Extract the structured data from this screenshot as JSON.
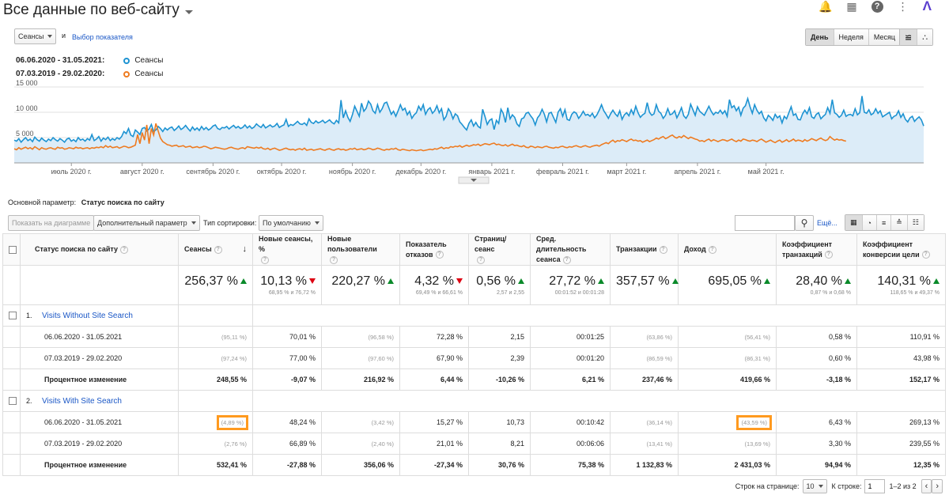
{
  "header": {
    "title": "Все данные по веб-сайту"
  },
  "controls": {
    "metric_select": "Сеансы",
    "and_label": "и",
    "choose_metric": "Выбор показателя",
    "periods": [
      "День",
      "Неделя",
      "Месяц"
    ],
    "active_period": "День"
  },
  "legend": [
    {
      "range": "06.06.2020 - 31.05.2021:",
      "series": "Сеансы",
      "color": "#1d93d2"
    },
    {
      "range": "07.03.2019 - 29.02.2020:",
      "series": "Сеансы",
      "color": "#ee7b21"
    }
  ],
  "chart_data": {
    "type": "line",
    "y_ticks": [
      "15 000",
      "10 000",
      "5 000"
    ],
    "y_tick_values": [
      15000,
      10000,
      5000
    ],
    "ylim": [
      0,
      15000
    ],
    "x_tick_labels": [
      "июль 2020 г.",
      "август 2020 г.",
      "сентябрь 2020 г.",
      "октябрь 2020 г.",
      "ноябрь 2020 г.",
      "декабрь 2020 г.",
      "январь 2021 г.",
      "февраль 2021 г.",
      "март 2021 г.",
      "апрель 2021 г.",
      "май 2021 г."
    ],
    "x_tick_days": [
      25,
      56,
      87,
      117,
      148,
      178,
      209,
      240,
      268,
      299,
      329
    ],
    "series": [
      {
        "name": "Сеансы",
        "color": "#1d93d2",
        "fill": "#dcecf8",
        "values": [
          4500,
          4300,
          4800,
          4100,
          4600,
          5000,
          4400,
          4700,
          4200,
          5100,
          4600,
          4300,
          4900,
          4500,
          4200,
          4700,
          4400,
          5000,
          4600,
          4300,
          4800,
          4500,
          4100,
          4700,
          4900,
          4300,
          4600,
          4200,
          5000,
          4500,
          4700,
          4300,
          4800,
          4500,
          5600,
          4400,
          4700,
          5200,
          4300,
          4900,
          4600,
          5100,
          4400,
          4800,
          4500,
          5000,
          4700,
          5200,
          6200,
          5800,
          6800,
          5500,
          5200,
          6500,
          6100,
          5600,
          6800,
          7000,
          6300,
          6700,
          7600,
          6200,
          6500,
          7200,
          6800,
          6200,
          6900,
          6500,
          6900,
          7100,
          6400,
          6800,
          7300,
          6600,
          6900,
          7400,
          6800,
          6300,
          7100,
          6500,
          6900,
          6400,
          7200,
          6600,
          7000,
          6500,
          6800,
          7300,
          7500,
          6800,
          6600,
          7000,
          6900,
          7200,
          6700,
          7100,
          7400,
          6900,
          7200,
          6800,
          7000,
          7500,
          6900,
          7300,
          6800,
          7100,
          7700,
          7300,
          7000,
          7600,
          6900,
          7200,
          7500,
          7100,
          7300,
          7800,
          7000,
          7300,
          7500,
          8600,
          7200,
          7600,
          7400,
          7800,
          8200,
          7700,
          7600,
          7900,
          7400,
          8700,
          8000,
          7800,
          8300,
          7900,
          8100,
          8400,
          7900,
          8200,
          8500,
          8000,
          7700,
          8400,
          7900,
          12400,
          8900,
          10300,
          9000,
          8200,
          9500,
          11200,
          10200,
          9200,
          11800,
          10200,
          10800,
          12200,
          11600,
          10300,
          9800,
          11500,
          10000,
          10700,
          11800,
          12000,
          10800,
          9600,
          10200,
          9200,
          10300,
          11500,
          10400,
          10800,
          9500,
          10200,
          8800,
          9500,
          9900,
          11200,
          10400,
          11500,
          9600,
          10500,
          10900,
          9800,
          10300,
          11300,
          9900,
          10700,
          8500,
          9200,
          10700,
          10000,
          8700,
          9700,
          9300,
          8100,
          7600,
          7000,
          6500,
          7800,
          8500,
          7300,
          8000,
          7200,
          6900,
          10600,
          9200,
          7600,
          8400,
          8700,
          6600,
          8400,
          7800,
          10600,
          9800,
          8000,
          10900,
          8700,
          9500,
          9000,
          7700,
          7200,
          8700,
          8900,
          9800,
          10000,
          9300,
          8700,
          7500,
          8900,
          9500,
          10600,
          9600,
          8100,
          9800,
          10000,
          9000,
          8000,
          10000,
          10700,
          9200,
          10500,
          8600,
          8400,
          9600,
          10100,
          9800,
          8800,
          9400,
          10200,
          9400,
          9600,
          9200,
          9800,
          8900,
          9500,
          10400,
          11500,
          10300,
          9600,
          8800,
          9700,
          10400,
          9700,
          9200,
          10300,
          8600,
          9500,
          9900,
          9300,
          10500,
          9600,
          11200,
          9900,
          9000,
          9500,
          9800,
          11900,
          10000,
          9400,
          9700,
          11500,
          10200,
          9800,
          8800,
          9400,
          10700,
          9500,
          9700,
          10300,
          8900,
          9800,
          10900,
          9300,
          8800,
          9600,
          11600,
          10500,
          9400,
          11100,
          10200,
          9800,
          9400,
          10300,
          11200,
          10200,
          9500,
          10000,
          9800,
          10400,
          9700,
          10300,
          9200,
          12500,
          10900,
          11300,
          10300,
          11000,
          9400,
          10800,
          11300,
          12700,
          11100,
          9800,
          11500,
          10400,
          9700,
          10200,
          8900,
          8300,
          9400,
          9000,
          8400,
          9600,
          8900,
          9300,
          7900,
          9200,
          8700,
          9900,
          11100,
          9400,
          9700,
          8600,
          8500,
          9700,
          10400,
          9700,
          10900,
          9100,
          8800,
          9600,
          9900,
          8700,
          9200,
          9600,
          10900,
          9800,
          12500,
          9900,
          9600,
          9000,
          9400,
          10400,
          9200,
          9500,
          9600,
          9300,
          10700,
          9500,
          9900,
          13200,
          10000,
          9800,
          10500,
          9500,
          9800,
          10700,
          9800,
          10300,
          9100,
          9400,
          9700,
          10000,
          8700,
          9200,
          9400,
          10300,
          9000,
          9700,
          8600,
          8100,
          8900,
          9200,
          8200,
          8700,
          9100,
          8500,
          7300
        ]
      },
      {
        "name": "Сеансы",
        "color": "#ee7b21",
        "values": [
          2800,
          2600,
          3000,
          2700,
          2900,
          3100,
          2800,
          3000,
          2700,
          3200,
          2900,
          2600,
          3000,
          2800,
          2700,
          2900,
          3000,
          2800,
          2700,
          3100,
          2900,
          3000,
          2700,
          2800,
          3000,
          2900,
          2800,
          3100,
          2900,
          3000,
          2800,
          2900,
          3000,
          2800,
          3000,
          2900,
          3100,
          3000,
          3200,
          3000,
          3400,
          3100,
          3300,
          3000,
          3100,
          3200,
          2900,
          3100,
          3300,
          3200,
          3000,
          3100,
          3300,
          3500,
          5600,
          3800,
          6000,
          4500,
          7500,
          3800,
          6800,
          5500,
          7800,
          6300,
          4900,
          4200,
          3900,
          3600,
          3500,
          3300,
          3400,
          3500,
          3200,
          3300,
          3400,
          3100,
          3200,
          3300,
          3000,
          3100,
          3200,
          3000,
          3100,
          3300,
          3200,
          3000,
          2800,
          2900,
          3100,
          3000,
          2900,
          2800,
          2700,
          2800,
          3000,
          3100,
          2900,
          2800,
          2700,
          2900,
          3000,
          2800,
          3200,
          3100,
          3000,
          2900,
          3100,
          2900,
          3100,
          2800,
          2700,
          2900,
          2600,
          2800,
          2900,
          2700,
          2500,
          2600,
          2800,
          2900,
          2700,
          2600,
          2700,
          2500,
          2700,
          2800,
          2600,
          2900,
          2500,
          2600,
          2700,
          2500,
          2600,
          2700,
          2800,
          2600,
          2500,
          2700,
          2800,
          2600,
          2500,
          2700,
          2800,
          2600,
          2700,
          2500,
          2600,
          2800,
          2700,
          2900,
          2600,
          2700,
          2800,
          2600,
          2700,
          2900,
          2800,
          2600,
          2700,
          2900,
          2800,
          2600,
          2500,
          2700,
          2600,
          2800,
          2700,
          2900,
          2600,
          2500,
          2700,
          2600,
          2500,
          2400,
          2600,
          2500,
          2400,
          2500,
          2600,
          2400,
          2500,
          2600,
          2700,
          2600,
          2800,
          2700,
          2900,
          3100,
          2800,
          3000,
          2900,
          3200,
          3100,
          3300,
          3200,
          3400,
          3100,
          3300,
          3500,
          3300,
          3400,
          3600,
          3500,
          3700,
          3400,
          3600,
          3800,
          3700,
          3600,
          3800,
          3900,
          3600,
          3700,
          3500,
          3400,
          3600,
          3300,
          3500,
          3700,
          3400,
          3500,
          3300,
          3200,
          3400,
          3100,
          3000,
          3300,
          3200,
          3000,
          3200,
          3100,
          3000,
          3200,
          3300,
          3100,
          3000,
          2900,
          3100,
          3000,
          3200,
          3300,
          3100,
          3000,
          3200,
          3100,
          3300,
          3400,
          3200,
          3100,
          3300,
          3400,
          3200,
          3100,
          3300,
          3400,
          3500,
          3300,
          3600,
          3800,
          4000,
          3800,
          4200,
          4500,
          4100,
          4400,
          4300,
          4600,
          4400,
          4200,
          4500,
          4700,
          4400,
          4500,
          4300,
          4400,
          4100,
          4300,
          4500,
          4200,
          4400,
          4600,
          4900,
          4700,
          5000,
          5200,
          4800,
          5000,
          5300,
          5500,
          5100,
          4900,
          5200,
          5000,
          5400,
          5100,
          4800,
          5100,
          4900,
          4700,
          4600,
          4300,
          4400,
          4200,
          4500,
          4700,
          4300,
          4600,
          4400,
          4200,
          4400,
          4600,
          4500,
          4300,
          4500,
          4700,
          4400,
          4200,
          4500,
          4300,
          4700,
          4600,
          4400,
          4300,
          4500,
          4400,
          4200,
          4500,
          4700,
          4400,
          4100,
          4300,
          4500,
          4200,
          4000,
          4300,
          4500,
          4100,
          4300,
          4600,
          4200,
          4400,
          4700,
          4300,
          4500,
          4400,
          4200,
          4600,
          4300,
          4500,
          4800,
          4600,
          4400,
          4700,
          4900,
          4600,
          4400,
          4600,
          5200,
          4800,
          4500,
          4700,
          4500,
          4600,
          4400,
          4300
        ]
      }
    ]
  },
  "dimension": {
    "label": "Основной параметр:",
    "value": "Статус поиска по сайту"
  },
  "toolbar": {
    "show_chart": "Показать на диаграмме",
    "secondary": "Дополнительный параметр",
    "sort_label": "Тип сортировки:",
    "sort_value": "По умолчанию",
    "search_placeholder": "",
    "more": "Ещё..."
  },
  "table": {
    "columns": [
      "Статус поиска по сайту",
      "Сеансы",
      "Новые сеансы, %",
      "Новые пользователи",
      "Показатель отказов",
      "Страниц/сеанс",
      "Сред. длительность сеанса",
      "Транзакции",
      "Доход",
      "Коэффициент транзакций",
      "Коэффициент конверсии цели"
    ],
    "totals": [
      {
        "value": "256,37 %",
        "dir": "up",
        "sub": ""
      },
      {
        "value": "10,13 %",
        "dir": "down",
        "sub": "68,95 % и 76,72 %"
      },
      {
        "value": "220,27 %",
        "dir": "up",
        "sub": ""
      },
      {
        "value": "4,32 %",
        "dir": "down",
        "sub": "69,49 % и 66,61 %"
      },
      {
        "value": "0,56 %",
        "dir": "up",
        "sub": "2,57 и 2,55"
      },
      {
        "value": "27,72 %",
        "dir": "up",
        "sub": "00:01:52 и 00:01:28"
      },
      {
        "value": "357,57 %",
        "dir": "up",
        "sub": ""
      },
      {
        "value": "695,05 %",
        "dir": "up",
        "sub": ""
      },
      {
        "value": "28,40 %",
        "dir": "up",
        "sub": "0,87 % и 0,68 %"
      },
      {
        "value": "140,31 %",
        "dir": "up",
        "sub": "118,65 % и 49,37 %"
      }
    ],
    "groups": [
      {
        "index": "1.",
        "name": "Visits Without Site Search",
        "rows": [
          {
            "label": "06.06.2020 - 31.05.2021",
            "cells": [
              "(95,11 %)",
              "70,01 %",
              "(96,58 %)",
              "72,28 %",
              "2,15",
              "00:01:25",
              "(63,86 %)",
              "(56,41 %)",
              "0,58 %",
              "110,91 %"
            ]
          },
          {
            "label": "07.03.2019 - 29.02.2020",
            "cells": [
              "(97,24 %)",
              "77,00 %",
              "(97,60 %)",
              "67,90 %",
              "2,39",
              "00:01:20",
              "(86,59 %)",
              "(86,31 %)",
              "0,60 %",
              "43,98 %"
            ]
          },
          {
            "label": "Процентное изменение",
            "cells": [
              "248,55 %",
              "-9,07 %",
              "216,92 %",
              "6,44 %",
              "-10,26 %",
              "6,21 %",
              "237,46 %",
              "419,66 %",
              "-3,18 %",
              "152,17 %"
            ]
          }
        ]
      },
      {
        "index": "2.",
        "name": "Visits With Site Search",
        "rows": [
          {
            "label": "06.06.2020 - 31.05.2021",
            "cells": [
              "(4,89 %)",
              "48,24 %",
              "(3,42 %)",
              "15,27 %",
              "10,73",
              "00:10:42",
              "(36,14 %)",
              "(43,59 %)",
              "6,43 %",
              "269,13 %"
            ]
          },
          {
            "label": "07.03.2019 - 29.02.2020",
            "cells": [
              "(2,76 %)",
              "66,89 %",
              "(2,40 %)",
              "21,01 %",
              "8,21",
              "00:06:06",
              "(13,41 %)",
              "(13,69 %)",
              "3,30 %",
              "239,55 %"
            ]
          },
          {
            "label": "Процентное изменение",
            "cells": [
              "532,41 %",
              "-27,88 %",
              "356,06 %",
              "-27,34 %",
              "30,76 %",
              "75,38 %",
              "1 132,83 %",
              "2 431,03 %",
              "94,94 %",
              "12,35 %"
            ]
          }
        ]
      }
    ]
  },
  "pagination": {
    "rows_label": "Строк на странице:",
    "rows_value": "10",
    "goto_label": "К строке:",
    "goto_value": "1",
    "range": "1–2 из 2"
  }
}
